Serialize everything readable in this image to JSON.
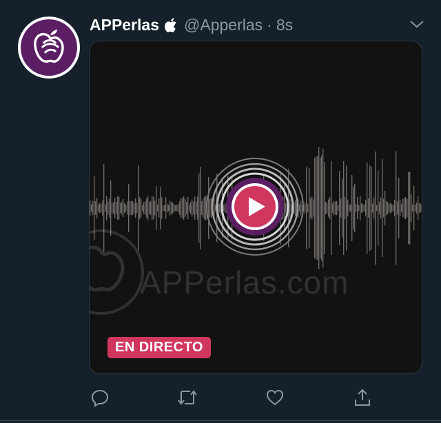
{
  "tweet": {
    "author_name": "APPerlas",
    "handle": "@Apperlas",
    "separator": "·",
    "time": "8s",
    "media": {
      "watermark_text": "APPerlas.com",
      "live_badge": "EN DIRECTO",
      "accent_color": "#d0375f",
      "ring_color": "#5b1e63"
    },
    "actions": [
      "reply-icon",
      "retweet-icon",
      "like-icon",
      "share-icon"
    ]
  },
  "colors": {
    "background": "#15202b",
    "secondary_text": "#8899a6",
    "brand_purple": "#5b1e63"
  }
}
